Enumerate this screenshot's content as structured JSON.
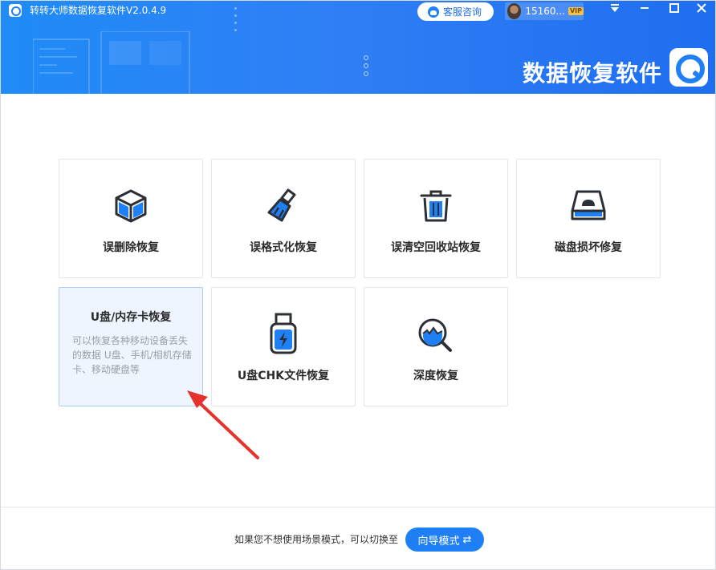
{
  "window": {
    "title": "转转大师数据恢复软件V2.0.4.9",
    "brand_text": "数据恢复软件",
    "customer_service_label": "客服咨询",
    "user_id": "15160...",
    "vip_badge": "VIP",
    "controls": [
      "menu",
      "minimize",
      "maximize",
      "close"
    ]
  },
  "colors": {
    "accent": "#1f80f5",
    "header_gradient_start": "#1f8cf7",
    "header_gradient_end": "#1f6ef0",
    "annotation_arrow": "#e5322d",
    "selected_card_bg": "#eef5fe"
  },
  "cards": [
    {
      "id": "deleted",
      "label": "误删除恢复",
      "icon": "box-icon"
    },
    {
      "id": "format",
      "label": "误格式化恢复",
      "icon": "broom-icon"
    },
    {
      "id": "recycle",
      "label": "误清空回收站恢复",
      "icon": "trash-icon"
    },
    {
      "id": "disk",
      "label": "磁盘损坏修复",
      "icon": "disk-icon"
    },
    {
      "id": "usb",
      "label": "U盘/内存卡恢复",
      "icon": "usb-icon",
      "selected": true,
      "description": "可以恢复各种移动设备丢失的数据 U盘、手机/相机存储卡、移动硬盘等"
    },
    {
      "id": "chk",
      "label": "U盘CHK文件恢复",
      "icon": "usb-drive-icon"
    },
    {
      "id": "deep",
      "label": "深度恢复",
      "icon": "magnifier-icon"
    }
  ],
  "footer": {
    "switch_text": "如果您不想使用场景模式，可以切换至",
    "mode_button": "向导模式",
    "swap_icon": "swap-arrows-icon"
  }
}
